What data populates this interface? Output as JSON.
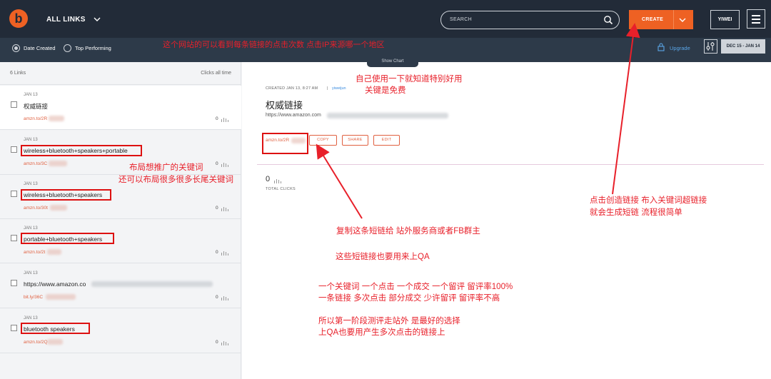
{
  "header": {
    "logo_letter": "b",
    "nav_label": "ALL LINKS",
    "search_placeholder": "SEARCH",
    "create_label": "CREATE",
    "user_label": "YIWEI"
  },
  "subbar": {
    "date_created": "Date Created",
    "top_performing": "Top Performing",
    "show_chart": "Show Chart",
    "upgrade": "Upgrade",
    "date_range": "DEC 15 - JAN 14"
  },
  "list": {
    "count_label": "6 Links",
    "clicks_label": "Clicks all time",
    "items": [
      {
        "date": "JAN 13",
        "title": "权威链接",
        "link": "amzn.to/2R",
        "clicks": "0"
      },
      {
        "date": "JAN 13",
        "title": "wireless+bluetooth+speakers+portable",
        "link": "amzn.to/3C",
        "clicks": "0"
      },
      {
        "date": "JAN 13",
        "title": "wireless+bluetooth+speakers",
        "link": "amzn.to/30t",
        "clicks": "0"
      },
      {
        "date": "JAN 13",
        "title": "portable+bluetooth+speakers",
        "link": "amzn.to/2t",
        "clicks": "0"
      },
      {
        "date": "JAN 13",
        "title": "https://www.amazon.co",
        "link": "bit.ly/36C",
        "clicks": "0"
      },
      {
        "date": "JAN 13",
        "title": "bluetooth speakers",
        "link": "amzn.to/2Q",
        "clicks": "0"
      }
    ]
  },
  "detail": {
    "created": "CREATED JAN 13, 8:27 AM",
    "separator": "|",
    "created_by": "yiweijun",
    "title": "权威链接",
    "long_url": "https://www.amazon.com",
    "short_link": "amzn.to/2R",
    "copy_label": "COPY",
    "share_label": "SHARE",
    "edit_label": "EDIT",
    "total_count": "0",
    "total_label": "TOTAL CLICKS"
  },
  "annotations": {
    "top": "这个网站的可以看到每条链接的点击次数  点击IP来源哪一个地区",
    "self_use_1": "自己使用一下就知道特别好用",
    "self_use_2": "关键是免费",
    "layout_1": "布局想推广的关键词",
    "layout_2": "还可以布局很多很多长尾关键词",
    "create_1": "点击创造链接  布入关键词超链接",
    "create_2": "就会生成短链  流程很简单",
    "copy": "复制这条短链给 站外服务商或者FB群主",
    "qa": "这些短链接也要用来上QA",
    "compare_1": "一个关键词   一个点击   一个成交   一个留评     留评率100%",
    "compare_2": "一条链接       多次点击   部分成交   少许留评     留评率不高",
    "conclusion_1": "所以第一阶段测评走站外 是最好的选择",
    "conclusion_2": "上QA也要用产生多次点击的链接上"
  },
  "colors": {
    "header_bg": "#222b38",
    "subbar_bg": "#2d3a49",
    "accent_orange": "#ee6123",
    "link_red": "#e06040",
    "annotation_red": "#e8202a"
  }
}
